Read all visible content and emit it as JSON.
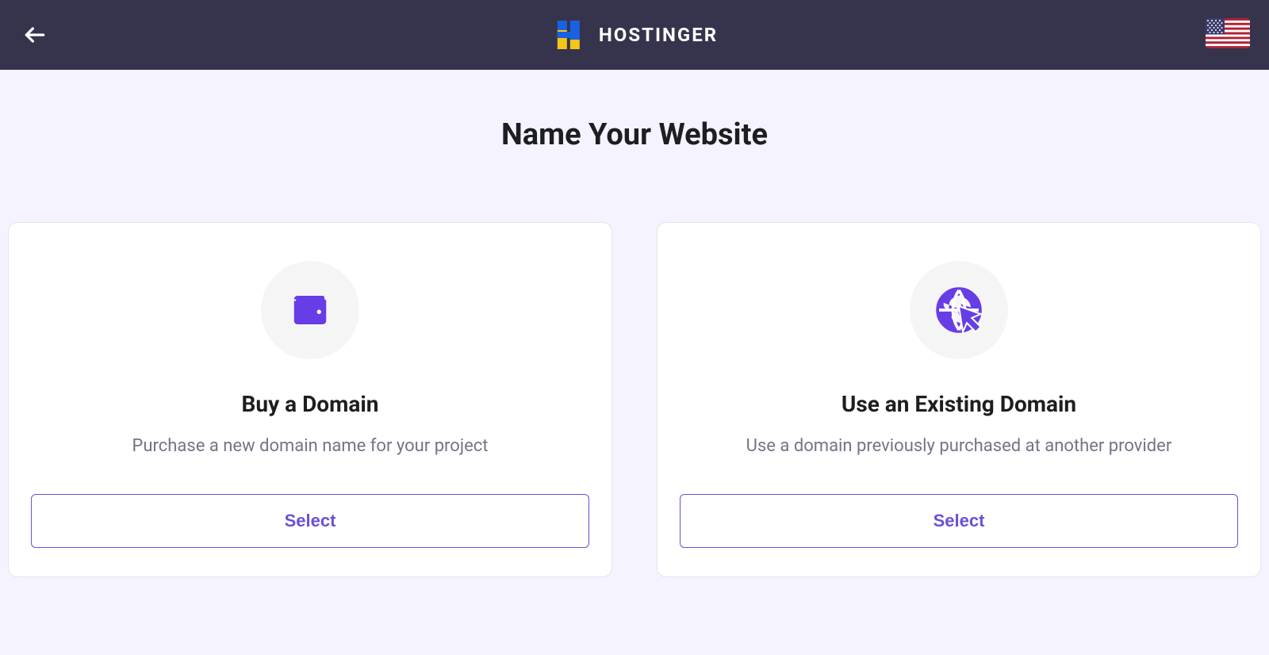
{
  "header": {
    "brand_name": "HOSTINGER",
    "locale_flag": "US"
  },
  "page": {
    "title": "Name Your Website"
  },
  "cards": [
    {
      "icon": "wallet-icon",
      "title": "Buy a Domain",
      "description": "Purchase a new domain name for your project",
      "button_label": "Select"
    },
    {
      "icon": "globe-cursor-icon",
      "title": "Use an Existing Domain",
      "description": "Use a domain previously purchased at another provider",
      "button_label": "Select"
    }
  ]
}
